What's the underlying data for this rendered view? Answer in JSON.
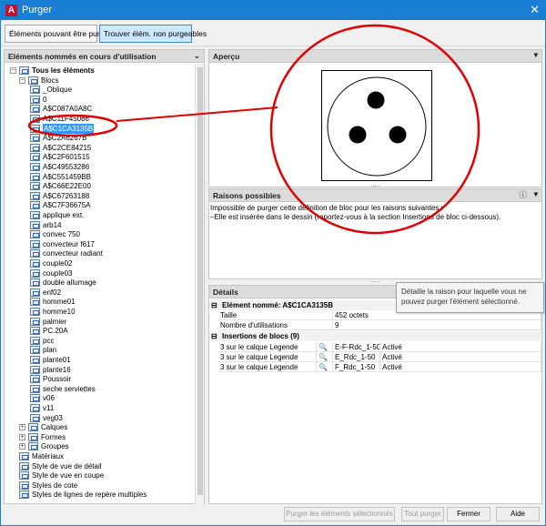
{
  "window": {
    "title": "Purger",
    "app_icon": "A"
  },
  "tabs": [
    "Éléments pouvant être purgés",
    "Trouver élém. non purgeables"
  ],
  "left": {
    "header": "Eléments nommés en cours d'utilisation",
    "root": "Tous les éléments",
    "blocks_group": "Blocs",
    "blocks": [
      "_Oblique",
      "0",
      "A$C087A0A8C",
      "A$C11F45086",
      "A$C1CA3135B",
      "A$C2A6267B",
      "A$C2CE84215",
      "A$C2F601515",
      "A$C49553286",
      "A$C551459BB",
      "A$C66E22E00",
      "A$C67263188",
      "A$C7F36675A",
      "applique ext.",
      "arb14",
      "convec 750",
      "convecteur f617",
      "convecteur radiant",
      "couple02",
      "couple03",
      "double allumage",
      "enf02",
      "homme01",
      "homme10",
      "palmier",
      "PC.20A",
      "pcc",
      "plan",
      "plante01",
      "plante16",
      "Poussoir",
      "seche serviettes",
      "v06",
      "v11",
      "veg03"
    ],
    "selected": "A$C1CA3135B",
    "other_groups": [
      "Calques",
      "Formes",
      "Groupes",
      "Matériaux",
      "Style de vue de détail",
      "Style de vue en coupe",
      "Styles de cote",
      "Styles de lignes de repère multiples"
    ]
  },
  "preview": {
    "header": "Aperçu"
  },
  "reasons": {
    "header": "Raisons possibles",
    "line1": "Impossible de purger cette définition de bloc pour les raisons suivantes :",
    "line2": "–Elle est insérée dans le dessin (reportez-vous à la section Insertions de bloc ci-dessous)."
  },
  "details": {
    "header": "Détails",
    "item_section": "Elément nommé: A$C1CA3135B",
    "size_label": "Taille",
    "size_value": "452 octets",
    "uses_label": "Nombre d'utilisations",
    "uses_value": "9",
    "insertions_section": "Insertions de blocs (9)",
    "insertions": [
      {
        "where": "3 sur le calque Legende",
        "layout": "E-F-Rdc_1-50",
        "status": "Activé"
      },
      {
        "where": "3 sur le calque Legende",
        "layout": "E_Rdc_1-50",
        "status": "Activé"
      },
      {
        "where": "3 sur le calque Legende",
        "layout": "F_Rdc_1-50",
        "status": "Activé"
      }
    ]
  },
  "tooltip": "Détaille la raison pour laquelle vous ne pouvez purger l'élément sélectionné.",
  "buttons": {
    "purge_selected": "Purger les éléments sélectionnés",
    "purge_all": "Tout purger",
    "close": "Fermer",
    "help": "Aide"
  },
  "splitter_glyph": "....."
}
